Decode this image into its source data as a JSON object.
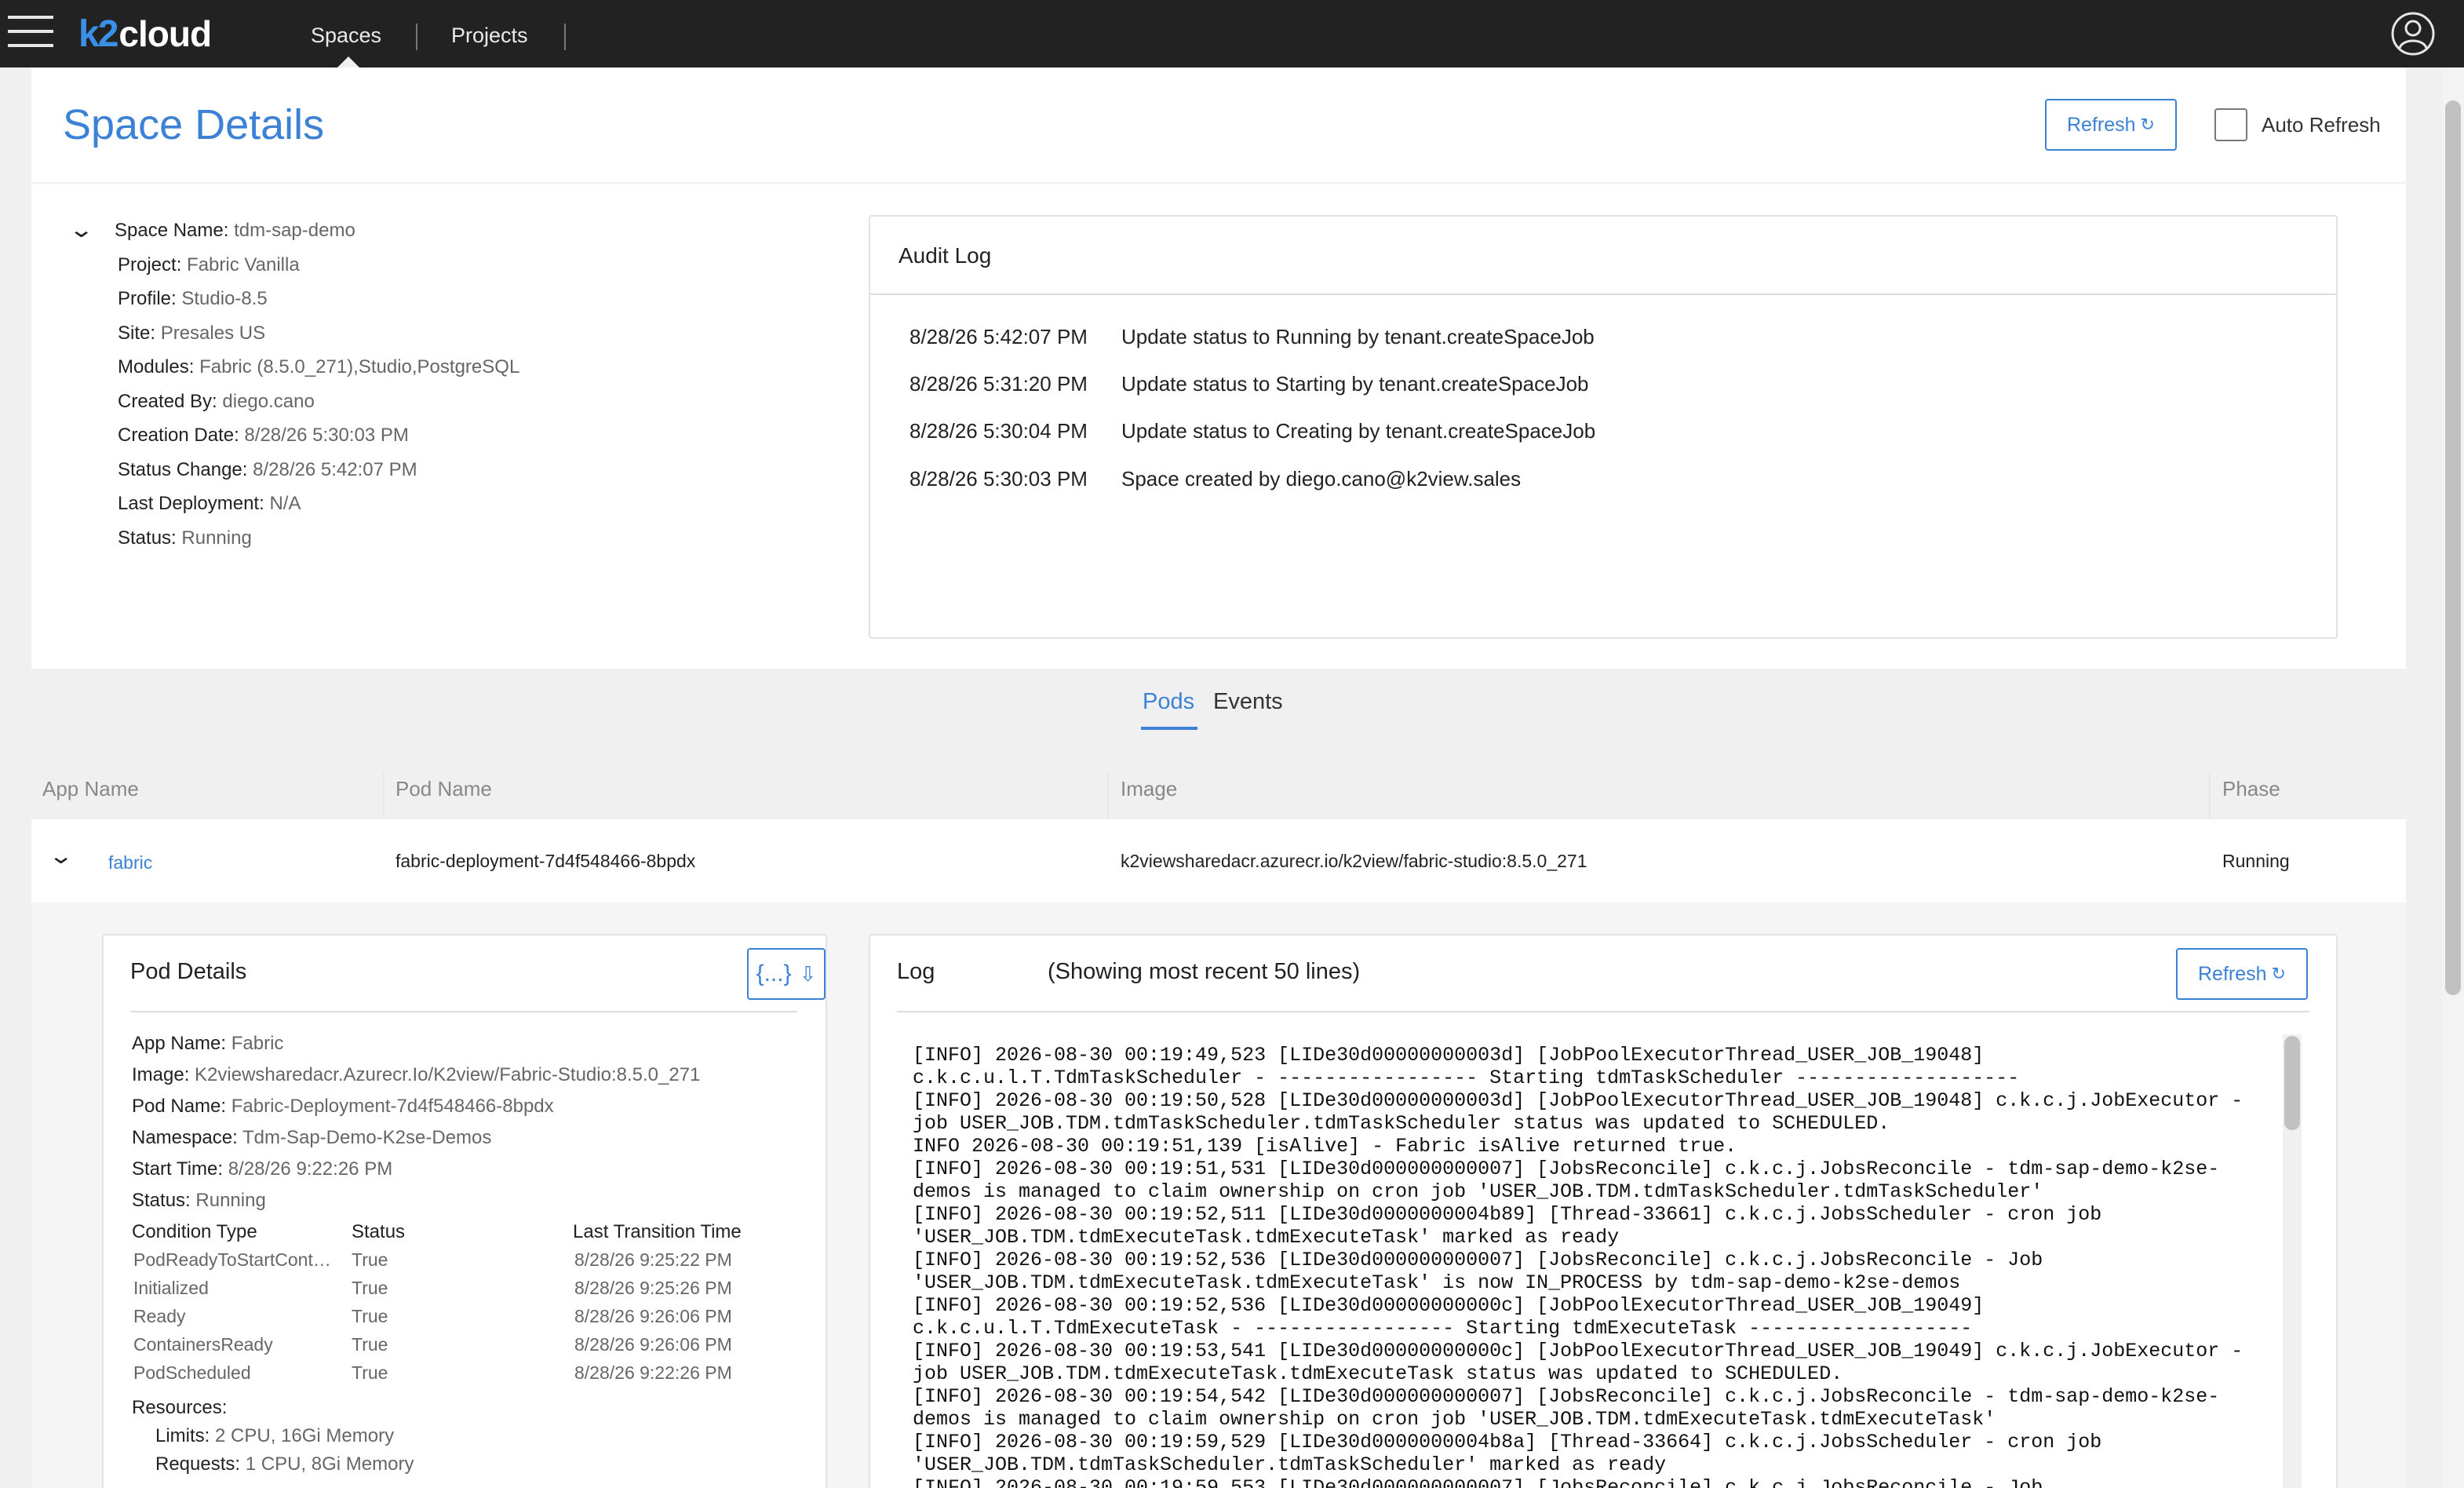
{
  "topbar": {
    "logo_k2": "k2",
    "logo_cloud": "cloud",
    "nav": [
      "Spaces",
      "Projects"
    ]
  },
  "header": {
    "title": "Space Details",
    "refresh_label": "Refresh",
    "refresh_icon": "↻",
    "auto_refresh_label": "Auto Refresh",
    "auto_refresh_checked": false
  },
  "details": {
    "fields": [
      {
        "label": "Space Name:",
        "value": "tdm-sap-demo"
      },
      {
        "label": "Project:",
        "value": "Fabric Vanilla"
      },
      {
        "label": "Profile:",
        "value": "Studio-8.5"
      },
      {
        "label": "Site:",
        "value": "Presales US"
      },
      {
        "label": "Modules:",
        "value": "Fabric (8.5.0_271),Studio,PostgreSQL"
      },
      {
        "label": "Created By:",
        "value": "diego.cano"
      },
      {
        "label": "Creation Date:",
        "value": "8/28/26 5:30:03 PM"
      },
      {
        "label": "Status Change:",
        "value": "8/28/26 5:42:07 PM"
      },
      {
        "label": "Last Deployment:",
        "value": "N/A"
      },
      {
        "label": "Status:",
        "value": "Running"
      }
    ]
  },
  "audit": {
    "title": "Audit Log",
    "rows": [
      {
        "time": "8/28/26 5:42:07 PM",
        "msg": "Update status to Running by tenant.createSpaceJob"
      },
      {
        "time": "8/28/26 5:31:20 PM",
        "msg": "Update status to Starting by tenant.createSpaceJob"
      },
      {
        "time": "8/28/26 5:30:04 PM",
        "msg": "Update status to Creating by tenant.createSpaceJob"
      },
      {
        "time": "8/28/26 5:30:03 PM",
        "msg": "Space created by diego.cano@k2view.sales"
      }
    ]
  },
  "tabs": [
    "Pods",
    "Events"
  ],
  "pods": {
    "columns": [
      "App Name",
      "Pod Name",
      "Image",
      "Phase"
    ],
    "row": {
      "app": "fabric",
      "pod": "fabric-deployment-7d4f548466-8bpdx",
      "image": "k2viewsharedacr.azurecr.io/k2view/fabric-studio:8.5.0_271",
      "phase": "Running"
    }
  },
  "pod_details": {
    "title": "Pod Details",
    "json_icon": "{...}",
    "download_icon": "⇩",
    "fields": [
      {
        "label": "App Name:",
        "value": "Fabric"
      },
      {
        "label": "Image:",
        "value": "K2viewsharedacr.Azurecr.Io/K2view/Fabric-Studio:8.5.0_271"
      },
      {
        "label": "Pod Name:",
        "value": "Fabric-Deployment-7d4f548466-8bpdx"
      },
      {
        "label": "Namespace:",
        "value": "Tdm-Sap-Demo-K2se-Demos"
      },
      {
        "label": "Start Time:",
        "value": "8/28/26 9:22:26 PM"
      },
      {
        "label": "Status:",
        "value": "Running"
      }
    ],
    "conditions_headers": [
      "Condition Type",
      "Status",
      "Last Transition Time"
    ],
    "conditions": [
      {
        "type": "PodReadyToStartCont…",
        "status": "True",
        "time": "8/28/26 9:25:22 PM"
      },
      {
        "type": "Initialized",
        "status": "True",
        "time": "8/28/26 9:25:26 PM"
      },
      {
        "type": "Ready",
        "status": "True",
        "time": "8/28/26 9:26:06 PM"
      },
      {
        "type": "ContainersReady",
        "status": "True",
        "time": "8/28/26 9:26:06 PM"
      },
      {
        "type": "PodScheduled",
        "status": "True",
        "time": "8/28/26 9:22:26 PM"
      }
    ],
    "resources_label": "Resources:",
    "limits_label": "Limits:",
    "limits_value": "2 CPU, 16Gi Memory",
    "requests_label": "Requests:",
    "requests_value": "1 CPU, 8Gi Memory"
  },
  "log": {
    "title": "Log",
    "subtitle": "(Showing most recent 50 lines)",
    "refresh_label": "Refresh",
    "refresh_icon": "↻",
    "text": "[INFO] 2026-08-30 00:19:49,523 [LIDe30d00000000003d] [JobPoolExecutorThread_USER_JOB_19048]\nc.k.c.u.l.T.TdmTaskScheduler - ----------------- Starting tdmTaskScheduler -------------------\n[INFO] 2026-08-30 00:19:50,528 [LIDe30d00000000003d] [JobPoolExecutorThread_USER_JOB_19048] c.k.c.j.JobExecutor -\njob USER_JOB.TDM.tdmTaskScheduler.tdmTaskScheduler status was updated to SCHEDULED.\nINFO 2026-08-30 00:19:51,139 [isAlive] - Fabric isAlive returned true.\n[INFO] 2026-08-30 00:19:51,531 [LIDe30d000000000007] [JobsReconcile] c.k.c.j.JobsReconcile - tdm-sap-demo-k2se-\ndemos is managed to claim ownership on cron job 'USER_JOB.TDM.tdmTaskScheduler.tdmTaskScheduler'\n[INFO] 2026-08-30 00:19:52,511 [LIDe30d0000000004b89] [Thread-33661] c.k.c.j.JobsScheduler - cron job\n'USER_JOB.TDM.tdmExecuteTask.tdmExecuteTask' marked as ready\n[INFO] 2026-08-30 00:19:52,536 [LIDe30d000000000007] [JobsReconcile] c.k.c.j.JobsReconcile - Job\n'USER_JOB.TDM.tdmExecuteTask.tdmExecuteTask' is now IN_PROCESS by tdm-sap-demo-k2se-demos\n[INFO] 2026-08-30 00:19:52,536 [LIDe30d00000000000c] [JobPoolExecutorThread_USER_JOB_19049]\nc.k.c.u.l.T.TdmExecuteTask - ----------------- Starting tdmExecuteTask -------------------\n[INFO] 2026-08-30 00:19:53,541 [LIDe30d00000000000c] [JobPoolExecutorThread_USER_JOB_19049] c.k.c.j.JobExecutor -\njob USER_JOB.TDM.tdmExecuteTask.tdmExecuteTask status was updated to SCHEDULED.\n[INFO] 2026-08-30 00:19:54,542 [LIDe30d000000000007] [JobsReconcile] c.k.c.j.JobsReconcile - tdm-sap-demo-k2se-\ndemos is managed to claim ownership on cron job 'USER_JOB.TDM.tdmExecuteTask.tdmExecuteTask'\n[INFO] 2026-08-30 00:19:59,529 [LIDe30d0000000004b8a] [Thread-33664] c.k.c.j.JobsScheduler - cron job\n'USER_JOB.TDM.tdmTaskScheduler.tdmTaskScheduler' marked as ready\n[INFO] 2026-08-30 00:19:59,553 [LIDe30d000000000007] [JobsReconcile] c.k.c.j.JobsReconcile - Job"
  }
}
